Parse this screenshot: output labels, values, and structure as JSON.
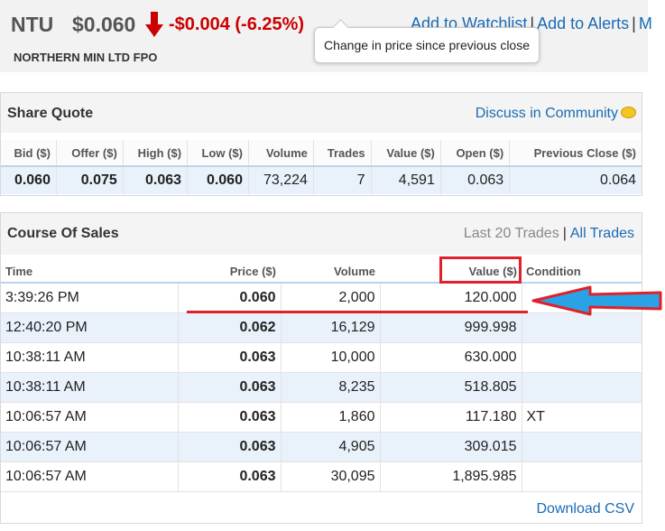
{
  "header": {
    "ticker": "NTU",
    "price": "$0.060",
    "change": "-$0.004 (-6.25%)",
    "company": "NORTHERN MIN LTD FPO",
    "links": [
      "Add to Watchlist",
      "Add to Alerts"
    ],
    "trailing_link": "M",
    "tooltip": "Change in price since previous close"
  },
  "share_quote": {
    "title": "Share Quote",
    "discuss_label": "Discuss in Community",
    "columns": [
      "Bid ($)",
      "Offer ($)",
      "High ($)",
      "Low ($)",
      "Volume",
      "Trades",
      "Value ($)",
      "Open ($)",
      "Previous Close ($)"
    ],
    "values": [
      "0.060",
      "0.075",
      "0.063",
      "0.060",
      "73,224",
      "7",
      "4,591",
      "0.063",
      "0.064"
    ]
  },
  "course_of_sales": {
    "title": "Course Of Sales",
    "last_trades_label": "Last 20 Trades",
    "all_trades_label": "All Trades",
    "columns": [
      "Time",
      "Price ($)",
      "Volume",
      "Value ($)",
      "Condition"
    ],
    "rows": [
      [
        "3:39:26 PM",
        "0.060",
        "2,000",
        "120.000",
        ""
      ],
      [
        "12:40:20 PM",
        "0.062",
        "16,129",
        "999.998",
        ""
      ],
      [
        "10:38:11 AM",
        "0.063",
        "10,000",
        "630.000",
        ""
      ],
      [
        "10:38:11 AM",
        "0.063",
        "8,235",
        "518.805",
        ""
      ],
      [
        "10:06:57 AM",
        "0.063",
        "1,860",
        "117.180",
        "XT"
      ],
      [
        "10:06:57 AM",
        "0.063",
        "4,905",
        "309.015",
        ""
      ],
      [
        "10:06:57 AM",
        "0.063",
        "30,095",
        "1,895.985",
        ""
      ]
    ],
    "download_label": "Download CSV"
  },
  "colors": {
    "accent_link": "#1a6bb5",
    "negative": "#cc0000",
    "annotation_red": "#e0202a",
    "annotation_blue": "#2aa3e6"
  }
}
